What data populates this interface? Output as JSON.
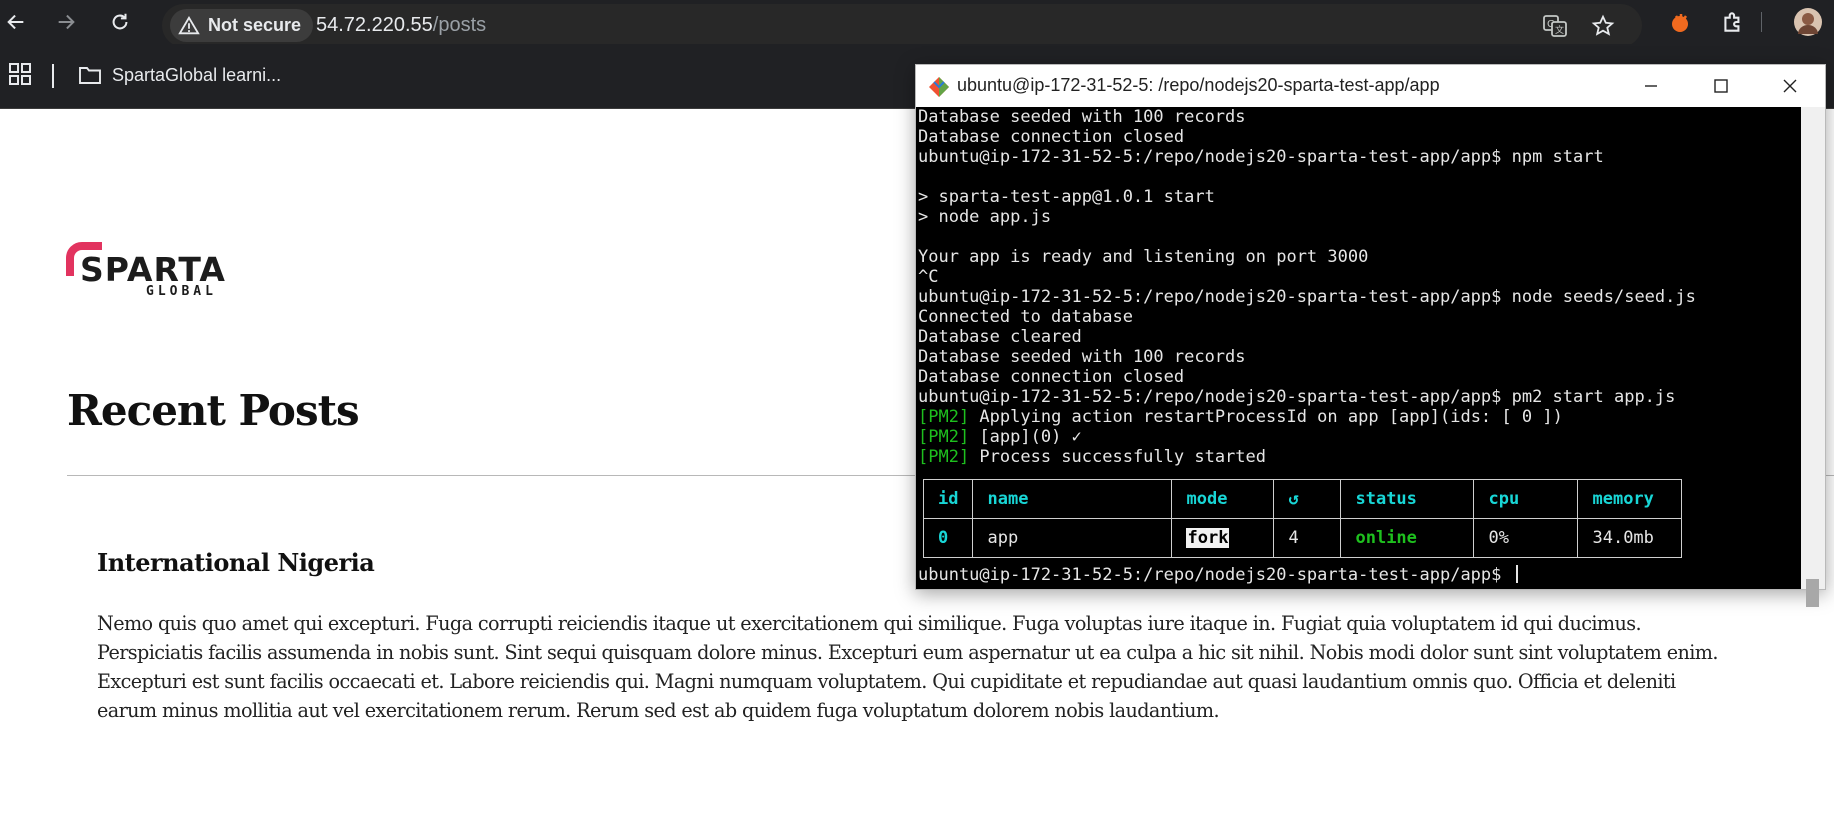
{
  "browser": {
    "security_badge": "Not secure",
    "url_host": "54.72.220.55",
    "url_path": "/posts",
    "bookmark_label": "SpartaGlobal learni..."
  },
  "page": {
    "logo_main": "SPARTA",
    "logo_sub": "GLOBAL",
    "title": "Recent Posts",
    "posts": [
      {
        "title": "International Nigeria",
        "body": "Nemo quis quo amet qui excepturi. Fuga corrupti reiciendis itaque ut exercitationem qui similique. Fuga voluptas iure itaque in. Fugiat quia voluptatem id qui ducimus. Perspiciatis facilis assumenda in nobis sunt. Sint sequi quisquam dolore minus. Excepturi eum aspernatur ut ea culpa a hic sit nihil. Nobis modi dolor sunt sint voluptatem enim. Excepturi est sunt facilis occaecati et. Labore reiciendis qui. Magni numquam voluptatem. Qui cupiditate et repudiandae aut quasi laudantium omnis quo. Officia et deleniti earum minus mollitia aut vel exercitationem rerum. Rerum sed est ab quidem fuga voluptatum dolorem nobis laudantium."
      }
    ]
  },
  "terminal": {
    "title": "ubuntu@ip-172-31-52-5: /repo/nodejs20-sparta-test-app/app",
    "lines": [
      "Database seeded with 100 records",
      "Database connection closed",
      "ubuntu@ip-172-31-52-5:/repo/nodejs20-sparta-test-app/app$ npm start",
      "",
      "> sparta-test-app@1.0.1 start",
      "> node app.js",
      "",
      "Your app is ready and listening on port 3000",
      "^C",
      "ubuntu@ip-172-31-52-5:/repo/nodejs20-sparta-test-app/app$ node seeds/seed.js",
      "Connected to database",
      "Database cleared",
      "Database seeded with 100 records",
      "Database connection closed",
      "ubuntu@ip-172-31-52-5:/repo/nodejs20-sparta-test-app/app$ pm2 start app.js"
    ],
    "pm2_tag": "[PM2]",
    "pm2_lines": [
      " Applying action restartProcessId on app [app](ids: [ 0 ])",
      " [app](0) ✓",
      " Process successfully started"
    ],
    "table": {
      "headers": [
        "id",
        "name",
        "mode",
        "↺",
        "status",
        "cpu",
        "memory"
      ],
      "row": {
        "id": "0",
        "name": "app",
        "mode": "fork",
        "restarts": "4",
        "status": "online",
        "cpu": "0%",
        "memory": "34.0mb"
      }
    },
    "prompt": "ubuntu@ip-172-31-52-5:/repo/nodejs20-sparta-test-app/app$ "
  },
  "colors": {
    "chrome_bg": "#202124",
    "terminal_bg": "#000000",
    "pm2_green": "#1ec01e",
    "pm2_cyan": "#18d6d6",
    "logo_accent": "#e2335f"
  }
}
